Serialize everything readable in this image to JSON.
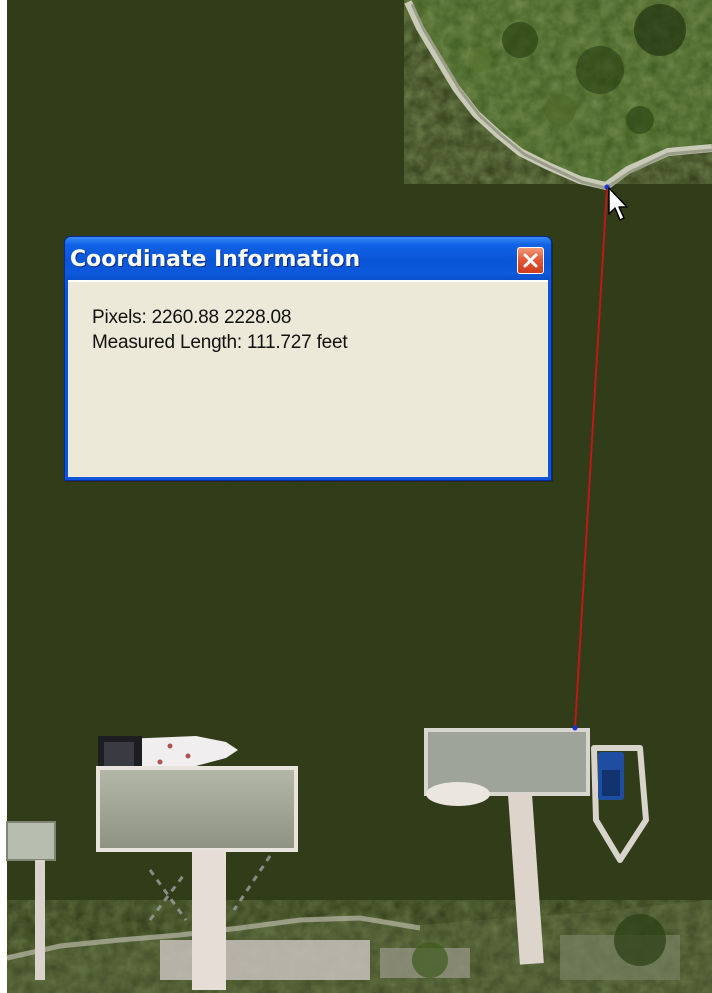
{
  "dialog": {
    "title": "Coordinate Information",
    "close_icon": "close-icon",
    "pixels_text": "Pixels: 2260.88 2228.08",
    "measured_length_text": "Measured Length: 111.727 feet"
  },
  "map": {
    "measurement_line_color": "#c01818",
    "water_color": "#2f3a18",
    "cursor_icon": "arrow-cursor-icon"
  }
}
